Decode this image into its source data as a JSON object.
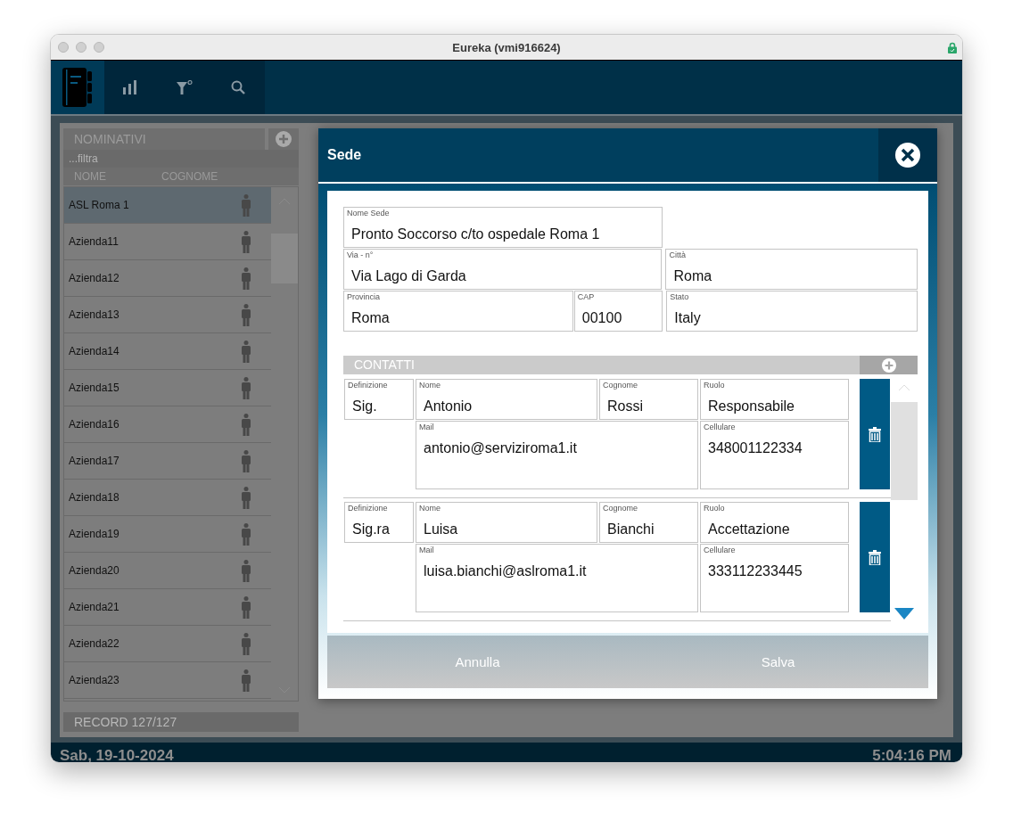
{
  "window": {
    "title": "Eureka (vmi916624)"
  },
  "toolbar": [
    {
      "selected": true
    },
    {
      "selected": false
    },
    {
      "selected": false
    },
    {
      "selected": false
    }
  ],
  "list": {
    "title": "NOMINATIVI",
    "filter_placeholder": "...filtra",
    "columns": [
      "NOME",
      "COGNOME"
    ],
    "rows": [
      {
        "name": "ASL Roma 1",
        "selected": true
      },
      {
        "name": "Azienda11",
        "selected": false
      },
      {
        "name": "Azienda12",
        "selected": false
      },
      {
        "name": "Azienda13",
        "selected": false
      },
      {
        "name": "Azienda14",
        "selected": false
      },
      {
        "name": "Azienda15",
        "selected": false
      },
      {
        "name": "Azienda16",
        "selected": false
      },
      {
        "name": "Azienda17",
        "selected": false
      },
      {
        "name": "Azienda18",
        "selected": false
      },
      {
        "name": "Azienda19",
        "selected": false
      },
      {
        "name": "Azienda20",
        "selected": false
      },
      {
        "name": "Azienda21",
        "selected": false
      },
      {
        "name": "Azienda22",
        "selected": false
      },
      {
        "name": "Azienda23",
        "selected": false
      }
    ],
    "record_count": "RECORD 127/127"
  },
  "dialog": {
    "title": "Sede",
    "fields": [
      {
        "label": "Nome Sede",
        "value": "Pronto Soccorso c/to ospedale Roma 1"
      },
      {
        "label": "Via - n°",
        "value": "Via Lago di Garda"
      },
      {
        "label": "Città",
        "value": "Roma"
      },
      {
        "label": "Provincia",
        "value": "Roma"
      },
      {
        "label": "CAP",
        "value": "00100"
      },
      {
        "label": "Stato",
        "value": "Italy"
      }
    ],
    "contacts": {
      "title": "CONTATTI",
      "items": [
        {
          "fields": [
            {
              "label": "Definizione",
              "value": "Sig."
            },
            {
              "label": "Nome",
              "value": "Antonio"
            },
            {
              "label": "Cognome",
              "value": "Rossi"
            },
            {
              "label": "Ruolo",
              "value": "Responsabile"
            },
            {
              "label": "Mail",
              "value": "antonio@serviziroma1.it"
            },
            {
              "label": "Cellulare",
              "value": "348001122334"
            }
          ]
        },
        {
          "fields": [
            {
              "label": "Definizione",
              "value": "Sig.ra"
            },
            {
              "label": "Nome",
              "value": "Luisa"
            },
            {
              "label": "Cognome",
              "value": "Bianchi"
            },
            {
              "label": "Ruolo",
              "value": "Accettazione"
            },
            {
              "label": "Mail",
              "value": "luisa.bianchi@aslroma1.it"
            },
            {
              "label": "Cellulare",
              "value": "333112233445"
            }
          ]
        }
      ]
    },
    "buttons": [
      "Annulla",
      "Salva"
    ]
  },
  "status_bar": {
    "date": "Sab, 19-10-2024",
    "time": "5:04:16 PM"
  }
}
